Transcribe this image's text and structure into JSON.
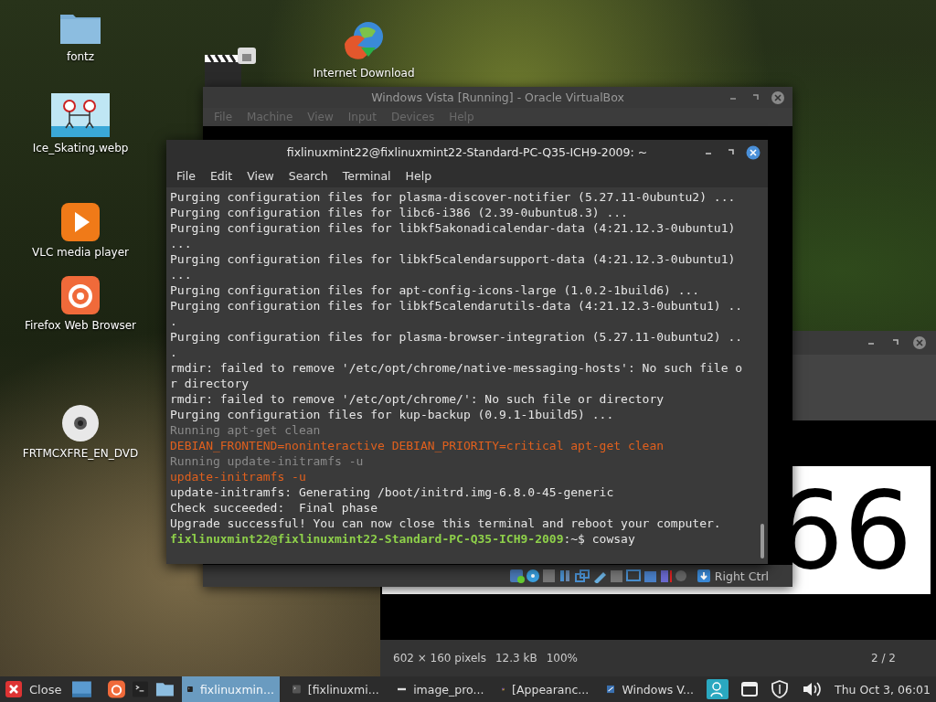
{
  "desktop_icons": [
    {
      "label": "fontz",
      "kind": "folder"
    },
    {
      "label": "Ice_Skating.webp",
      "kind": "image"
    },
    {
      "label": "VLC media player",
      "kind": "vlc"
    },
    {
      "label": "Firefox Web Browser",
      "kind": "firefox"
    },
    {
      "label": "FRTMCXFRE_EN_DVD",
      "kind": "disc"
    },
    {
      "label": "Internet Download",
      "kind": "download"
    }
  ],
  "virtualbox_window": {
    "title": "Windows Vista [Running] - Oracle VirtualBox",
    "menu": [
      {
        "label": "File",
        "disabled": true
      },
      {
        "label": "Machine",
        "disabled": true
      },
      {
        "label": "View",
        "disabled": true
      },
      {
        "label": "Input",
        "disabled": true
      },
      {
        "label": "Devices",
        "disabled": true
      },
      {
        "label": "Help",
        "disabled": true
      }
    ],
    "host_key": "Right Ctrl"
  },
  "terminal": {
    "title": "fixlinuxmint22@fixlinuxmint22-Standard-PC-Q35-ICH9-2009: ~",
    "menu": [
      "File",
      "Edit",
      "View",
      "Search",
      "Terminal",
      "Help"
    ],
    "lines": [
      {
        "kind": "output",
        "text": "Purging configuration files for plasma-discover-notifier (5.27.11-0ubuntu2) ..."
      },
      {
        "kind": "output",
        "text": "Purging configuration files for libc6-i386 (2.39-0ubuntu8.3) ..."
      },
      {
        "kind": "output",
        "text": "Purging configuration files for libkf5akonadicalendar-data (4:21.12.3-0ubuntu1)"
      },
      {
        "kind": "output",
        "text": "..."
      },
      {
        "kind": "output",
        "text": "Purging configuration files for libkf5calendarsupport-data (4:21.12.3-0ubuntu1)"
      },
      {
        "kind": "output",
        "text": "..."
      },
      {
        "kind": "output",
        "text": "Purging configuration files for apt-config-icons-large (1.0.2-1build6) ..."
      },
      {
        "kind": "output",
        "text": "Purging configuration files for libkf5calendarutils-data (4:21.12.3-0ubuntu1) .."
      },
      {
        "kind": "output",
        "text": "."
      },
      {
        "kind": "output",
        "text": "Purging configuration files for plasma-browser-integration (5.27.11-0ubuntu2) .."
      },
      {
        "kind": "output",
        "text": "."
      },
      {
        "kind": "output",
        "text": "rmdir: failed to remove '/etc/opt/chrome/native-messaging-hosts': No such file o"
      },
      {
        "kind": "output",
        "text": "r directory"
      },
      {
        "kind": "output",
        "text": "rmdir: failed to remove '/etc/opt/chrome/': No such file or directory"
      },
      {
        "kind": "output",
        "text": "Purging configuration files for kup-backup (0.9.1-1build5) ..."
      },
      {
        "kind": "info",
        "text": "Running apt-get clean"
      },
      {
        "kind": "command",
        "text": "DEBIAN_FRONTEND=noninteractive DEBIAN_PRIORITY=critical apt-get clean"
      },
      {
        "kind": "info",
        "text": "Running update-initramfs -u"
      },
      {
        "kind": "command",
        "text": "update-initramfs -u"
      },
      {
        "kind": "output",
        "text": "update-initramfs: Generating /boot/initrd.img-6.8.0-45-generic"
      },
      {
        "kind": "output",
        "text": "Check succeeded:  Final phase"
      },
      {
        "kind": "output",
        "text": "Upgrade successful! You can now close this terminal and reboot your computer."
      }
    ],
    "prompt": {
      "user_host": "fixlinuxmint22@fixlinuxmint22-Standard-PC-Q35-ICH9-2009",
      "path": ":~$",
      "command": "cowsay"
    }
  },
  "image_viewer": {
    "image_text": "66",
    "dimensions": "602 × 160 pixels",
    "size": "12.3 kB",
    "zoom": "100%",
    "page": "2 / 2"
  },
  "taskbar": {
    "menu_label": "Close",
    "tasks": [
      {
        "label": "fixlinuxmin...",
        "kind": "terminal",
        "selected": true
      },
      {
        "label": "[fixlinuxmi...",
        "kind": "terminal",
        "selected": false
      },
      {
        "label": "image_pro...",
        "kind": "image",
        "selected": false
      },
      {
        "label": "[Appearanc...",
        "kind": "appearance",
        "selected": false
      },
      {
        "label": "Windows V...",
        "kind": "virtualbox",
        "selected": false
      }
    ],
    "clock": "Thu Oct 3, 06:01"
  }
}
